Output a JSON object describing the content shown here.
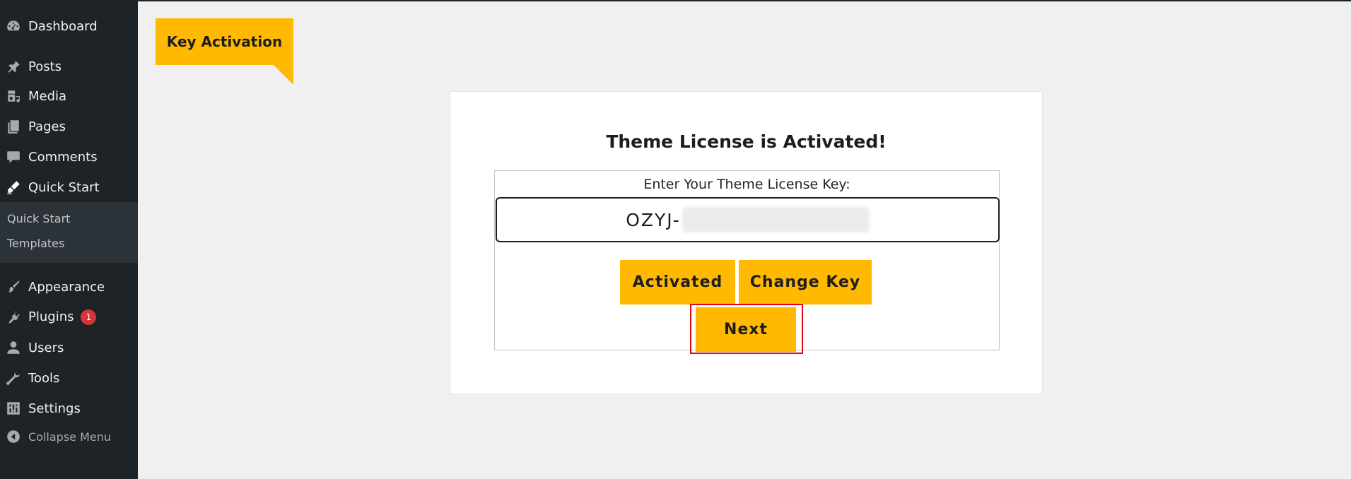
{
  "sidebar": {
    "items": [
      {
        "label": "Dashboard",
        "icon": "dashboard-icon"
      },
      {
        "label": "Posts",
        "icon": "pin-icon"
      },
      {
        "label": "Media",
        "icon": "media-icon"
      },
      {
        "label": "Pages",
        "icon": "pages-icon"
      },
      {
        "label": "Comments",
        "icon": "comment-icon"
      },
      {
        "label": "Quick Start",
        "icon": "quickstart-icon"
      },
      {
        "label": "Appearance",
        "icon": "brush-icon"
      },
      {
        "label": "Plugins",
        "icon": "plugin-icon",
        "badge": "1"
      },
      {
        "label": "Users",
        "icon": "user-icon"
      },
      {
        "label": "Tools",
        "icon": "wrench-icon"
      },
      {
        "label": "Settings",
        "icon": "settings-icon"
      },
      {
        "label": "Collapse Menu",
        "icon": "collapse-icon"
      }
    ],
    "submenu": [
      {
        "label": "Quick Start"
      },
      {
        "label": "Templates"
      }
    ]
  },
  "tab": {
    "label": "Key Activation"
  },
  "card": {
    "title": "Theme License is Activated!",
    "field_label": "Enter Your Theme License Key:",
    "key_prefix": "OZYJ-",
    "buttons": {
      "activated": "Activated",
      "change_key": "Change Key",
      "next": "Next"
    }
  },
  "colors": {
    "accent": "#ffb900",
    "sidebar_bg": "#1d2327",
    "highlight": "#e30613",
    "badge": "#d63638"
  }
}
